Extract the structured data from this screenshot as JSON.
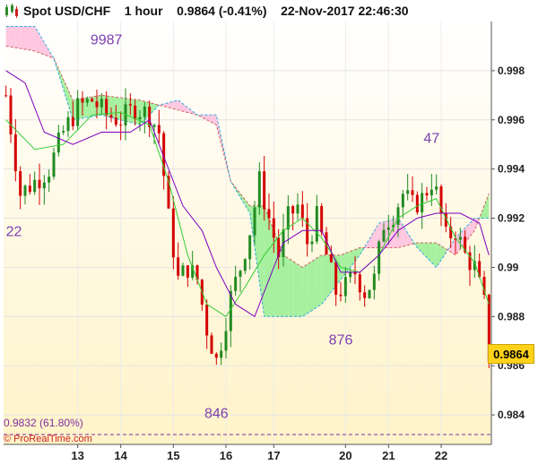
{
  "header": {
    "symbol": "Spot USD/CHF",
    "timeframe": "1 hour",
    "price": "0.9864",
    "change": "(-0.41%)",
    "datetime": "22-Nov-2017 22:46:30"
  },
  "chart_data": {
    "type": "candlestick",
    "y_ticks": [
      "0.998",
      "0.996",
      "0.994",
      "0.992",
      "0.99",
      "0.988",
      "0.986",
      "0.984"
    ],
    "ylim": [
      0.9828,
      1.0
    ],
    "x_ticks": [
      {
        "label": "13",
        "bar": 15
      },
      {
        "label": "14",
        "bar": 24
      },
      {
        "label": "15",
        "bar": 35
      },
      {
        "label": "16",
        "bar": 46
      },
      {
        "label": "17",
        "bar": 56
      },
      {
        "label": "20",
        "bar": 71
      },
      {
        "label": "21",
        "bar": 80
      },
      {
        "label": "22",
        "bar": 91
      }
    ],
    "bar_count": 102,
    "close_path": [
      [
        0,
        0.997
      ],
      [
        3,
        0.993
      ],
      [
        6,
        0.9935
      ],
      [
        9,
        0.994
      ],
      [
        12,
        0.9955
      ],
      [
        15,
        0.9965
      ],
      [
        18,
        0.9968
      ],
      [
        21,
        0.9962
      ],
      [
        24,
        0.996
      ],
      [
        27,
        0.9965
      ],
      [
        30,
        0.9962
      ],
      [
        32,
        0.9955
      ],
      [
        34,
        0.992
      ],
      [
        36,
        0.9895
      ],
      [
        38,
        0.99
      ],
      [
        40,
        0.9895
      ],
      [
        42,
        0.9875
      ],
      [
        44,
        0.9862
      ],
      [
        45,
        0.987
      ],
      [
        47,
        0.9888
      ],
      [
        49,
        0.99
      ],
      [
        51,
        0.9915
      ],
      [
        53,
        0.9935
      ],
      [
        55,
        0.992
      ],
      [
        57,
        0.9905
      ],
      [
        59,
        0.992
      ],
      [
        61,
        0.9925
      ],
      [
        63,
        0.991
      ],
      [
        65,
        0.992
      ],
      [
        67,
        0.9905
      ],
      [
        69,
        0.989
      ],
      [
        71,
        0.9892
      ],
      [
        73,
        0.9898
      ],
      [
        75,
        0.989
      ],
      [
        77,
        0.9895
      ],
      [
        79,
        0.9918
      ],
      [
        81,
        0.9922
      ],
      [
        83,
        0.993
      ],
      [
        85,
        0.9925
      ],
      [
        87,
        0.9928
      ],
      [
        89,
        0.9935
      ],
      [
        90,
        0.993
      ],
      [
        92,
        0.9912
      ],
      [
        94,
        0.9915
      ],
      [
        96,
        0.9905
      ],
      [
        98,
        0.99
      ],
      [
        100,
        0.9885
      ],
      [
        101,
        0.9864
      ]
    ],
    "tenkan": [
      [
        0,
        0.996
      ],
      [
        6,
        0.9948
      ],
      [
        12,
        0.995
      ],
      [
        18,
        0.9962
      ],
      [
        24,
        0.9963
      ],
      [
        30,
        0.9958
      ],
      [
        34,
        0.9935
      ],
      [
        38,
        0.9905
      ],
      [
        42,
        0.9885
      ],
      [
        46,
        0.988
      ],
      [
        50,
        0.9892
      ],
      [
        54,
        0.9905
      ],
      [
        58,
        0.9915
      ],
      [
        62,
        0.992
      ],
      [
        66,
        0.9912
      ],
      [
        70,
        0.99
      ],
      [
        74,
        0.9898
      ],
      [
        78,
        0.9905
      ],
      [
        82,
        0.992
      ],
      [
        86,
        0.9925
      ],
      [
        90,
        0.9928
      ],
      [
        94,
        0.9912
      ],
      [
        98,
        0.9902
      ],
      [
        101,
        0.9885
      ]
    ],
    "kijun": [
      [
        0,
        0.998
      ],
      [
        4,
        0.9975
      ],
      [
        8,
        0.9955
      ],
      [
        14,
        0.995
      ],
      [
        20,
        0.9955
      ],
      [
        26,
        0.9955
      ],
      [
        30,
        0.996
      ],
      [
        33,
        0.9945
      ],
      [
        37,
        0.9925
      ],
      [
        41,
        0.9915
      ],
      [
        44,
        0.99
      ],
      [
        48,
        0.9885
      ],
      [
        52,
        0.988
      ],
      [
        55,
        0.9895
      ],
      [
        58,
        0.991
      ],
      [
        62,
        0.9915
      ],
      [
        66,
        0.9915
      ],
      [
        70,
        0.9898
      ],
      [
        74,
        0.9898
      ],
      [
        78,
        0.9905
      ],
      [
        82,
        0.9915
      ],
      [
        86,
        0.992
      ],
      [
        90,
        0.9922
      ],
      [
        95,
        0.9922
      ],
      [
        99,
        0.9918
      ],
      [
        101,
        0.9905
      ]
    ],
    "senkou_a": [
      [
        0,
        0.999
      ],
      [
        6,
        0.9988
      ],
      [
        10,
        0.9985
      ],
      [
        14,
        0.9968
      ],
      [
        20,
        0.997
      ],
      [
        28,
        0.9968
      ],
      [
        32,
        0.9966
      ],
      [
        36,
        0.9964
      ],
      [
        40,
        0.9962
      ],
      [
        44,
        0.9958
      ],
      [
        47,
        0.9935
      ],
      [
        51,
        0.9925
      ],
      [
        54,
        0.9925
      ],
      [
        58,
        0.9905
      ],
      [
        62,
        0.99
      ],
      [
        66,
        0.9905
      ],
      [
        70,
        0.9905
      ],
      [
        74,
        0.9908
      ],
      [
        78,
        0.9908
      ],
      [
        82,
        0.9908
      ],
      [
        86,
        0.991
      ],
      [
        90,
        0.991
      ],
      [
        94,
        0.9905
      ],
      [
        98,
        0.9915
      ],
      [
        101,
        0.993
      ]
    ],
    "senkou_b": [
      [
        0,
        0.9998
      ],
      [
        6,
        0.9998
      ],
      [
        10,
        0.9985
      ],
      [
        14,
        0.996
      ],
      [
        20,
        0.9962
      ],
      [
        28,
        0.9958
      ],
      [
        32,
        0.9966
      ],
      [
        36,
        0.9968
      ],
      [
        40,
        0.9962
      ],
      [
        44,
        0.9962
      ],
      [
        47,
        0.9935
      ],
      [
        51,
        0.9922
      ],
      [
        54,
        0.988
      ],
      [
        58,
        0.988
      ],
      [
        62,
        0.988
      ],
      [
        66,
        0.9885
      ],
      [
        70,
        0.9895
      ],
      [
        74,
        0.9905
      ],
      [
        78,
        0.9918
      ],
      [
        82,
        0.992
      ],
      [
        86,
        0.9908
      ],
      [
        90,
        0.99
      ],
      [
        94,
        0.9912
      ],
      [
        98,
        0.992
      ],
      [
        101,
        0.992
      ]
    ],
    "annotations": [
      {
        "text": "9987",
        "bar": 21,
        "price": 0.9987,
        "pos": "above"
      },
      {
        "text": "22",
        "bar": 0,
        "price": 0.992,
        "pos": "below"
      },
      {
        "text": "846",
        "bar": 44,
        "price": 0.9846,
        "pos": "below"
      },
      {
        "text": "876",
        "bar": 70,
        "price": 0.9876,
        "pos": "below"
      },
      {
        "text": "47",
        "bar": 89,
        "price": 0.9947,
        "pos": "above"
      }
    ],
    "fib_level": {
      "price": 0.9832,
      "label": "0.9832 (61.80%)"
    },
    "last_price": "0.9864",
    "colors": {
      "up": "#228b22",
      "down": "#d40000",
      "tenkan": "#33cc33",
      "kijun": "#7f00bf",
      "cloud_bull": "#a7f0a0",
      "cloud_bear": "#ffc8e0",
      "price_tag": "#ffd21a",
      "fib": "#7f2fa0"
    }
  },
  "footer": {
    "watermark": "© ProRealTime.com"
  }
}
